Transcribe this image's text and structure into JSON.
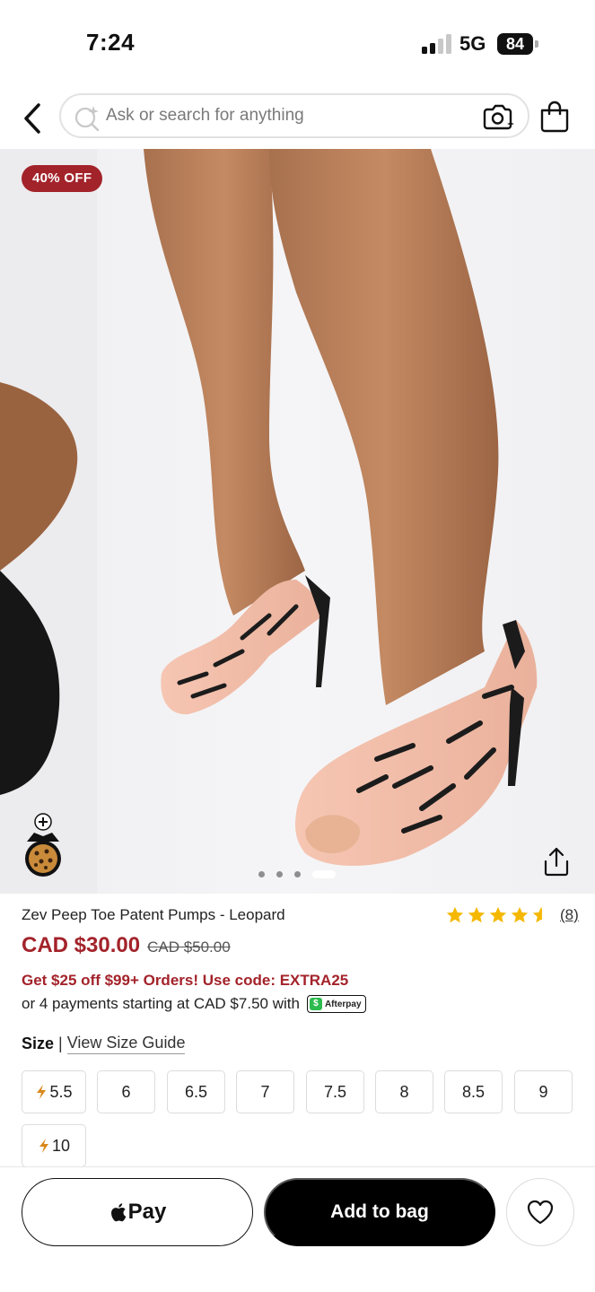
{
  "status_bar": {
    "time": "7:24",
    "network": "5G",
    "battery": "84"
  },
  "search": {
    "placeholder": "Ask or search for anything",
    "icons": [
      "back-chevron-icon",
      "ai-search-icon",
      "camera-search-icon",
      "shopping-bag-icon"
    ]
  },
  "hero": {
    "badge": "40% OFF",
    "carousel_count": 4,
    "carousel_active": 3,
    "icons": [
      "add-avatar-icon",
      "share-icon"
    ]
  },
  "product": {
    "title": "Zev Peep Toe Patent Pumps - Leopard",
    "rating": 4.5,
    "review_count": "(8)",
    "price": "CAD $30.00",
    "original_price": "CAD $50.00",
    "promo": "Get $25 off $99+ Orders! Use code: EXTRA25",
    "installments": "or 4 payments starting at CAD $7.50 with",
    "afterpay_label": "Afterpay"
  },
  "size": {
    "label": "Size",
    "separator": "|",
    "guide": "View Size Guide",
    "options": [
      {
        "label": "5.5",
        "low_stock": true
      },
      {
        "label": "6",
        "low_stock": false
      },
      {
        "label": "6.5",
        "low_stock": false
      },
      {
        "label": "7",
        "low_stock": false
      },
      {
        "label": "7.5",
        "low_stock": false
      },
      {
        "label": "8",
        "low_stock": false
      },
      {
        "label": "8.5",
        "low_stock": false
      },
      {
        "label": "9",
        "low_stock": false
      },
      {
        "label": "10",
        "low_stock": true
      }
    ]
  },
  "actions": {
    "apple_pay": "Pay",
    "add_to_bag": "Add to bag"
  },
  "colors": {
    "accent_red": "#a3232a",
    "afterpay_green": "#2dbb4f",
    "star_yellow": "#f5b800",
    "bolt_orange": "#d9881a"
  }
}
